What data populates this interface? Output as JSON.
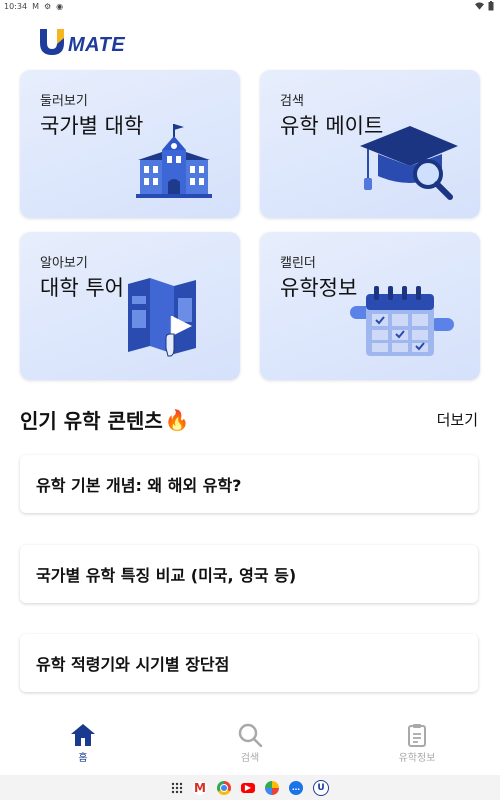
{
  "status_bar": {
    "time": "10:34"
  },
  "brand": {
    "logo_text": "MATE"
  },
  "cards": [
    {
      "sub": "둘러보기",
      "title": "국가별 대학",
      "icon": "university-building-icon"
    },
    {
      "sub": "검색",
      "title": "유학 메이트",
      "icon": "graduation-cap-search-icon"
    },
    {
      "sub": "알아보기",
      "title": "대학 투어",
      "icon": "tour-map-flag-icon"
    },
    {
      "sub": "캘린더",
      "title": "유학정보",
      "icon": "calendar-icon"
    }
  ],
  "popular": {
    "title": "인기 유학 콘텐츠",
    "more_label": "더보기",
    "items": [
      "유학 기본 개념: 왜 해외 유학?",
      "국가별 유학 특징 비교 (미국, 영국 등)",
      "유학 적령기와 시기별 장단점"
    ]
  },
  "bottom_nav": [
    {
      "label": "홈",
      "active": true
    },
    {
      "label": "검색",
      "active": false
    },
    {
      "label": "유학정보",
      "active": false
    }
  ],
  "colors": {
    "accent": "#1a3a8f",
    "card_bg": "#dfe8fc",
    "inactive": "#a9a9a9"
  }
}
